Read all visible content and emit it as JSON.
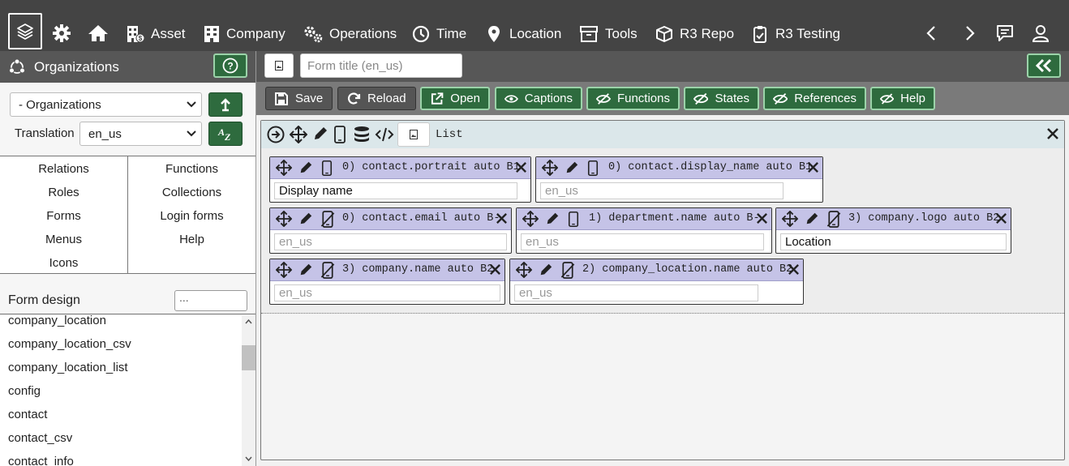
{
  "nav": {
    "logo_icon": "layers-icon",
    "items": [
      {
        "label": "Asset",
        "icon": "building-money-icon"
      },
      {
        "label": "Company",
        "icon": "building-icon"
      },
      {
        "label": "Operations",
        "icon": "gears-icon"
      },
      {
        "label": "Time",
        "icon": "clock-icon"
      },
      {
        "label": "Location",
        "icon": "map-pin-icon"
      },
      {
        "label": "Tools",
        "icon": "archive-box-icon"
      },
      {
        "label": "R3 Repo",
        "icon": "package-icon"
      },
      {
        "label": "R3 Testing",
        "icon": "clipboard-check-icon"
      }
    ],
    "right_icons": [
      "chevron-left-icon",
      "chevron-right-icon",
      "chat-icon",
      "user-icon"
    ]
  },
  "sidebar": {
    "title": "Organizations",
    "module_select": "- Organizations",
    "translation_label": "Translation",
    "translation_select": "en_us",
    "menu_left": [
      "Relations",
      "Roles",
      "Forms",
      "Menus",
      "Icons"
    ],
    "menu_right": [
      "Functions",
      "Collections",
      "Login forms",
      "Help"
    ],
    "form_design_label": "Form design",
    "filter_value": "...",
    "list_items": [
      "company_location",
      "company_location_csv",
      "company_location_list",
      "config",
      "contact",
      "contact_csv",
      "contact_info"
    ]
  },
  "main": {
    "form_title_placeholder": "Form title (en_us)",
    "toolbar": {
      "save": "Save",
      "reload": "Reload",
      "open": "Open",
      "captions": "Captions",
      "functions": "Functions",
      "states": "States",
      "references": "References",
      "help": "Help"
    },
    "container_label": "List",
    "fields": [
      {
        "text": "0) contact.portrait auto B1",
        "input": "Display name",
        "placeholder": false,
        "mobile_hidden": false
      },
      {
        "text": "0) contact.display_name auto B1",
        "input": "en_us",
        "placeholder": true,
        "mobile_hidden": false
      },
      {
        "text": "0) contact.email auto B-",
        "input": "en_us",
        "placeholder": true,
        "mobile_hidden": true
      },
      {
        "text": "1) department.name auto B-",
        "input": "en_us",
        "placeholder": true,
        "mobile_hidden": false
      },
      {
        "text": "3) company.logo auto B2",
        "input": "Location",
        "placeholder": false,
        "mobile_hidden": true
      },
      {
        "text": "3) company.name auto B2",
        "input": "en_us",
        "placeholder": true,
        "mobile_hidden": true
      },
      {
        "text": "2) company_location.name auto B2",
        "input": "en_us",
        "placeholder": true,
        "mobile_hidden": true
      }
    ]
  },
  "colors": {
    "topbar": "#444444",
    "header": "#575757",
    "accent_green": "#2e6b3e",
    "field_header": "#c5c3e7",
    "container_header": "#dbe7ea"
  }
}
